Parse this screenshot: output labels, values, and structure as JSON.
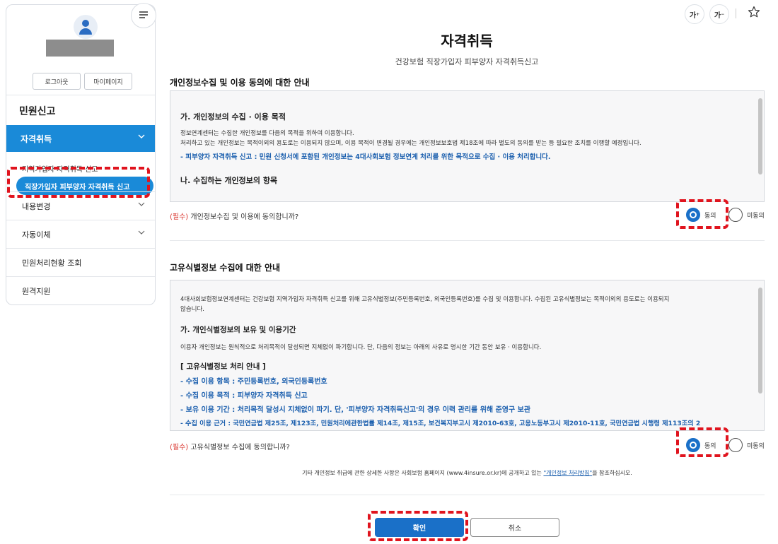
{
  "sidebar": {
    "logout_label": "로그아웃",
    "mypage_label": "마이페이지",
    "section_title": "민원신고",
    "active_item": "자격취득",
    "sub_items": [
      "지역가입자 자격취득 신고",
      "직장가입자 피부양자 자격취득 신고"
    ],
    "items": [
      "내용변경",
      "자동이체",
      "민원처리현황 조회",
      "원격지원"
    ]
  },
  "tools": {
    "font_up": "가",
    "font_down": "가",
    "star_icon": "star-icon",
    "menu_icon": "hamburger-icon"
  },
  "page": {
    "title": "자격취득",
    "subtitle": "건강보험 직장가입자 피부양자 자격취득신고"
  },
  "privacy": {
    "section_title": "개인정보수집 및 이용 동의에 대한 안내",
    "heading1": "가. 개인정보의 수집 · 이용 목적",
    "p1": "정보연계센터는 수집한 개인정보를 다음의 목적을 위하여 이용합니다.",
    "p2": "처리하고 있는 개인정보는 목적이외의 용도로는 이용되지 않으며, 이용 목적이 변경될 경우에는 개인정보보호법 제18조에 따라 별도의 동의를 받는 등 필요한 조치를 이행할 예정입니다.",
    "blue1": "- 피부양자 자격취득 신고 : 민원 신청서에 포함된 개인정보는 4대사회보험 정보연계 처리를 위한 목적으로 수집 · 이용 처리합니다.",
    "heading2": "나. 수집하는 개인정보의 항목",
    "question_req": "(필수)",
    "question": " 개인정보수집 및 이용에 동의합니까?",
    "agree": "동의",
    "disagree": "미동의"
  },
  "unique_id": {
    "section_title": "고유식별정보 수집에 대한 안내",
    "p1": "4대사회보험정보연계센터는 건강보험 지역가입자 자격취득 신고를 위해 고유식별정보(주민등록번호, 외국인등록번호)를 수집 및 이용합니다. 수집된 고유식별정보는 목적이외의 용도로는 이용되지",
    "p1b": "않습니다.",
    "heading1": "가. 개인식별정보의 보유 및 이용기간",
    "p2": "이용자 개인정보는 원칙적으로 처리목적이 달성되면 지체없이 파기합니다. 단, 다음의 정보는 아래의 사유로 명시한 기간 동안 보유 · 이용합니다.",
    "heading2": "[ 고유식별정보 처리 안내 ]",
    "blue_items": [
      "- 수집 이용 항목 : 주민등록번호, 외국인등록번호",
      "- 수집 이용 목적 : 피부양자 자격취득 신고",
      "- 보유 이용 기간 : 처리목적 달성시 지체없이 파기. 단, '피부양자 자격취득신고'의 경우 이력 관리를 위해 준영구 보관",
      "- 수집 이용 근거 : 국민연금법 제25조, 제123조, 민원처리에관한법률 제14조, 제15조, 보건복지부고시 제2010-63호, 고용노동부고시 제2010-11호, 국민연금법 시행령 제113조의 2"
    ],
    "question_req": "(필수)",
    "question": " 고유식별정보 수집에 동의합니까?",
    "agree": "동의",
    "disagree": "미동의"
  },
  "note": {
    "before": "기타 개인정보 취급에 관한 상세한 사항은 사회보험 홈페이지 (www.4insure.or.kr)에 공개하고 있는 ",
    "link": "\"개인정보 처리방침\"",
    "after": "을 참조하십시오."
  },
  "buttons": {
    "confirm": "확인",
    "cancel": "취소"
  },
  "colors": {
    "accent": "#1a8ad8",
    "primary_button": "#1a70c8",
    "highlight": "#e0141e",
    "required": "#d9322b"
  }
}
